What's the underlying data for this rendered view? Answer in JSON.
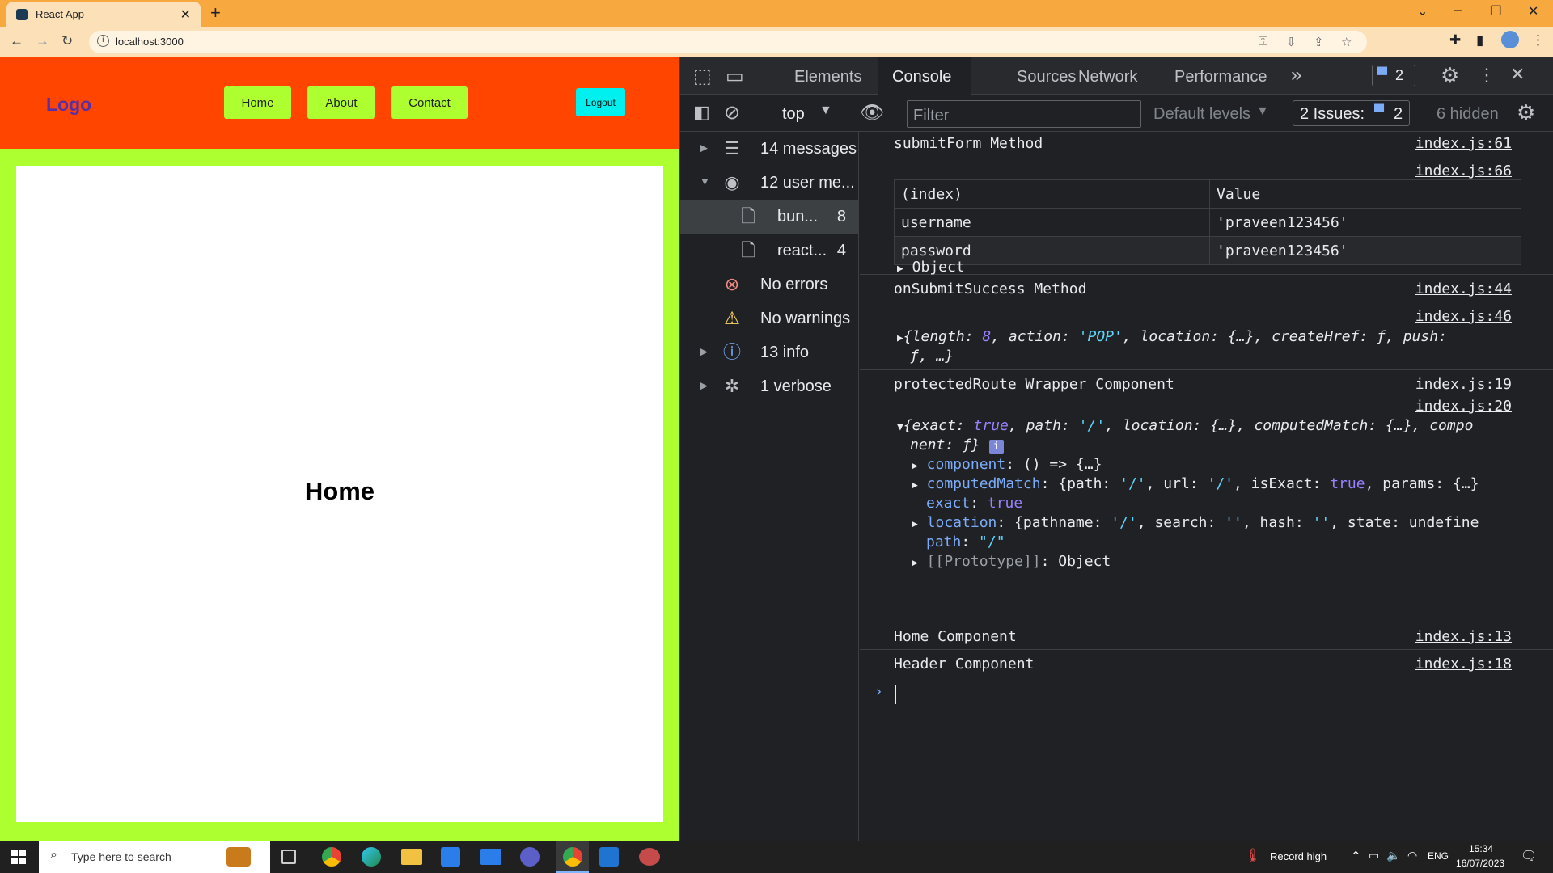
{
  "browser": {
    "tab_title": "React App",
    "tab_close": "✕",
    "new_tab": "+",
    "url": "localhost:3000",
    "window_controls": {
      "collapse": "⌄",
      "minimize": "–",
      "restore": "❐",
      "close": "✕"
    }
  },
  "app": {
    "logo": "Logo",
    "nav": [
      "Home",
      "About",
      "Contact"
    ],
    "logout": "Logout",
    "heading": "Home",
    "colors": {
      "navbar": "#ff4500",
      "nav_button": "#adff2f",
      "logout": "#00f0f0",
      "page_bg": "#adff2f",
      "logo": "#5a2ea6"
    }
  },
  "devtools": {
    "tabs": [
      "Elements",
      "Console",
      "Sources",
      "Network",
      "Performance"
    ],
    "active_tab": "Console",
    "more_tabs": "»",
    "issue_badge": "2",
    "toolbar": {
      "context": "top",
      "filter_placeholder": "Filter",
      "levels": "Default levels",
      "issues_label": "2 Issues:",
      "issues_count": "2",
      "hidden": "6 hidden"
    },
    "sidebar": [
      {
        "label": "14 messages",
        "count": "",
        "icon": "list-icon",
        "expandable": "collapsed"
      },
      {
        "label": "12 user me...",
        "count": "",
        "icon": "user-icon",
        "expandable": "expanded"
      },
      {
        "label": "bun...",
        "count": "8",
        "icon": "file-icon",
        "expandable": "none"
      },
      {
        "label": "react...",
        "count": "4",
        "icon": "file-icon",
        "expandable": "none"
      },
      {
        "label": "No errors",
        "count": "",
        "icon": "error-icon",
        "expandable": "none"
      },
      {
        "label": "No warnings",
        "count": "",
        "icon": "warning-icon",
        "expandable": "none"
      },
      {
        "label": "13 info",
        "count": "",
        "icon": "info-icon",
        "expandable": "collapsed"
      },
      {
        "label": "1 verbose",
        "count": "",
        "icon": "bug-icon",
        "expandable": "collapsed"
      }
    ],
    "console": {
      "m1": {
        "text": "submitForm Method",
        "src": "index.js:61"
      },
      "m2": {
        "src": "index.js:66",
        "table": {
          "headers": [
            "(index)",
            "Value"
          ],
          "rows": [
            {
              "key": "username",
              "value": "'praveen123456'"
            },
            {
              "key": "password",
              "value": "'praveen123456'"
            }
          ]
        },
        "object_label": "Object"
      },
      "m3": {
        "text": "onSubmitSuccess Method",
        "src": "index.js:44"
      },
      "m4": {
        "src": "index.js:46",
        "p1": "{",
        "k1": "length",
        "v1": "8",
        "k2": "action",
        "v2": "'POP'",
        "k3": "location",
        "v3": "{…}",
        "k4": "createHref",
        "v4": "ƒ",
        "k5": "push",
        "line2_v": "ƒ",
        "line2_tail": ", …}"
      },
      "m5": {
        "text": "protectedRoute Wrapper Component",
        "src": "index.js:19"
      },
      "m6": {
        "src": "index.js:20",
        "l1_open": "{",
        "l1_k1": "exact",
        "l1_v1": "true",
        "l1_k2": "path",
        "l1_v2": "'/'",
        "l1_k3": "location",
        "l1_v3": "{…}",
        "l1_k4": "computedMatch",
        "l1_v4": "{…}",
        "l1_k5": "compo",
        "l2_k": "nent",
        "l2_v": "ƒ}",
        "info_badge": "i",
        "props": {
          "component": {
            "key": "component",
            "value": "() => {…}"
          },
          "computedMatch": {
            "key": "computedMatch",
            "a": "{path: ",
            "b": "'/'",
            "c": ", url: ",
            "d": "'/'",
            "e": ", isExact: ",
            "f": "true",
            "g": ", params: {…}"
          },
          "exact": {
            "key": "exact",
            "value": "true"
          },
          "location": {
            "key": "location",
            "a": "{pathname: ",
            "b": "'/'",
            "c": ", search: ",
            "d": "''",
            "e": ", hash: ",
            "f": "''",
            "g": ", state: undefine"
          },
          "path": {
            "key": "path",
            "value": "\"/\""
          },
          "prototype": {
            "key": "[[Prototype]]",
            "value": "Object"
          }
        }
      },
      "m7": {
        "text": "Home Component",
        "src": "index.js:13"
      },
      "m8": {
        "text": "Header Component",
        "src": "index.js:18"
      },
      "prompt": "›"
    }
  },
  "taskbar": {
    "search_placeholder": "Type here to search",
    "weather": "Record high",
    "lang": "ENG",
    "time": "15:34",
    "date": "16/07/2023"
  }
}
